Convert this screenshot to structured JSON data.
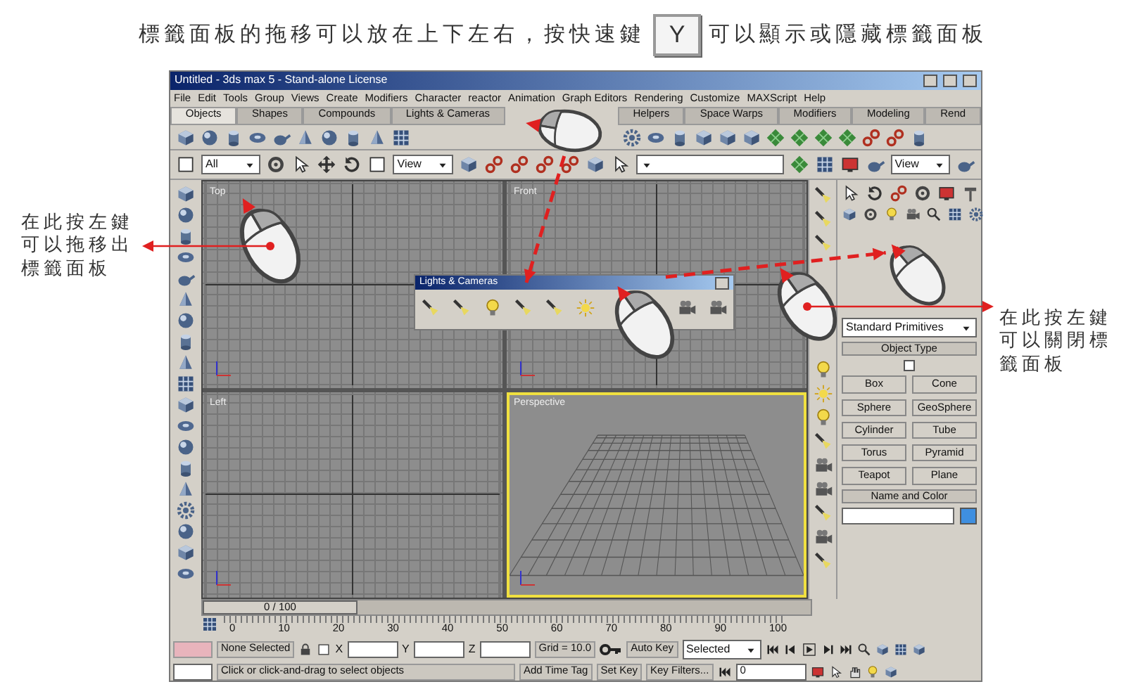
{
  "caption": {
    "before": "標籤面板的拖移可以放在上下左右，按快速鍵",
    "key": "Y",
    "after": "可以顯示或隱藏標籤面板"
  },
  "annotations": [
    {
      "text": "在此按左鍵可以拖移出標籤面板"
    },
    {
      "text": "在此按左鍵可以關閉標籤面板"
    }
  ],
  "window": {
    "title": "Untitled - 3ds max 5 - Stand-alone License"
  },
  "menu": [
    "File",
    "Edit",
    "Tools",
    "Group",
    "Views",
    "Create",
    "Modifiers",
    "Character",
    "reactor",
    "Animation",
    "Graph Editors",
    "Rendering",
    "Customize",
    "MAXScript",
    "Help"
  ],
  "tabs": [
    {
      "label": "Objects",
      "selected": true
    },
    {
      "label": "Shapes",
      "selected": false
    },
    {
      "label": "Compounds",
      "selected": false
    },
    {
      "label": "Lights & Cameras",
      "selected": false
    },
    {
      "label": "Helpers",
      "selected": false
    },
    {
      "label": "Space Warps",
      "selected": false
    },
    {
      "label": "Modifiers",
      "selected": false
    },
    {
      "label": "Modeling",
      "selected": false
    },
    {
      "label": "Rend",
      "selected": false
    }
  ],
  "main_toolbar": {
    "selection_filter": "All",
    "reference_coord": "View",
    "render_view": "View"
  },
  "viewports": [
    {
      "label": "Top",
      "active": false
    },
    {
      "label": "Front",
      "active": false
    },
    {
      "label": "Left",
      "active": false
    },
    {
      "label": "Perspective",
      "active": true
    }
  ],
  "floating_toolbar": {
    "title": "Lights & Cameras"
  },
  "command_panel": {
    "category": "Standard Primitives",
    "autogrid_checked": false,
    "rollouts": [
      {
        "title": "Object Type",
        "buttons": [
          "Box",
          "Cone",
          "Sphere",
          "GeoSphere",
          "Cylinder",
          "Tube",
          "Torus",
          "Pyramid",
          "Teapot",
          "Plane"
        ]
      },
      {
        "title": "Name and Color",
        "color": "#3f8fe0"
      }
    ]
  },
  "time_slider": {
    "reading": "0 / 100",
    "level": 0
  },
  "ruler": [
    "0",
    "10",
    "20",
    "30",
    "40",
    "50",
    "60",
    "70",
    "80",
    "90",
    "100"
  ],
  "status": {
    "selection": "None Selected",
    "x_label": "X",
    "y_label": "Y",
    "z_label": "Z",
    "grid": "Grid = 10.0",
    "prompt": "Click or click-and-drag to select objects",
    "time_tag": "Add Time Tag",
    "auto_key": "Auto Key",
    "key_mode": "Selected",
    "set_key": "Set Key",
    "key_filters": "Key Filters...",
    "frame": "0"
  }
}
